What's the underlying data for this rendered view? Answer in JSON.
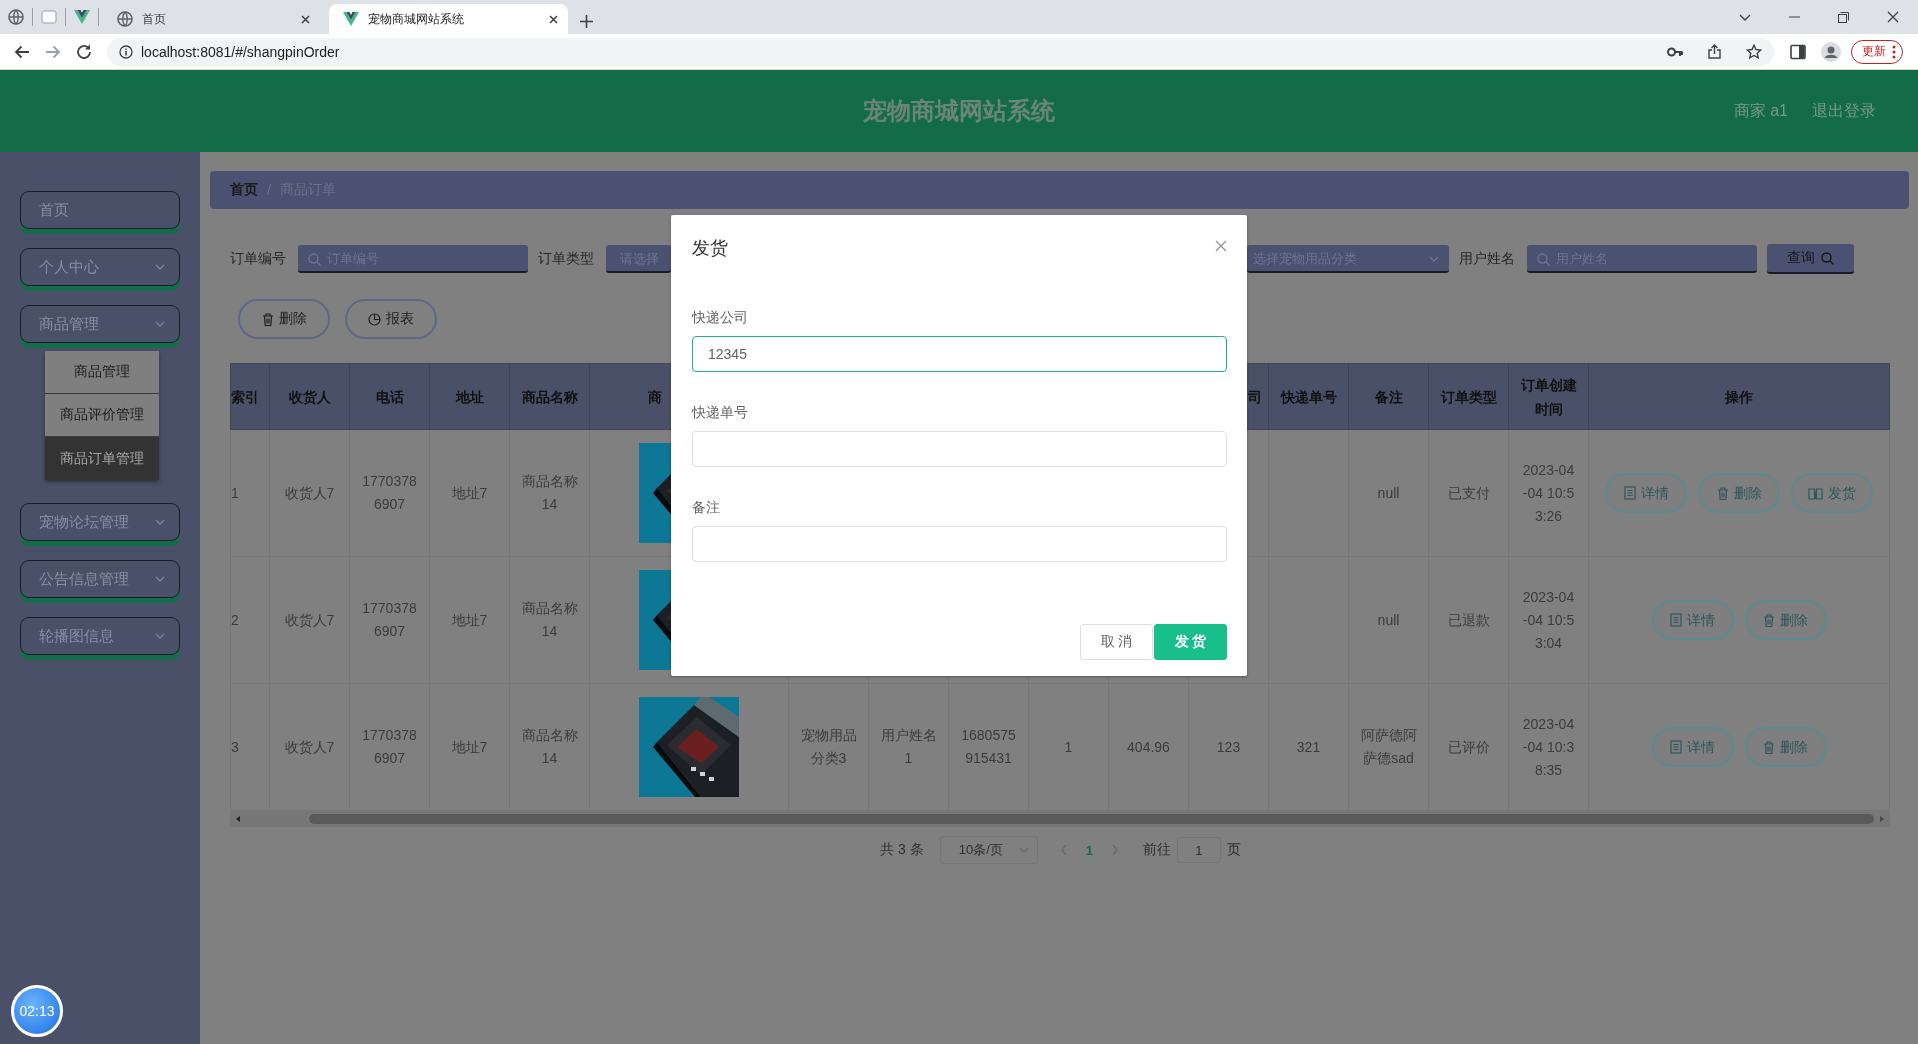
{
  "browser": {
    "tabs": [
      {
        "title": "首页",
        "kind": "globe",
        "selected": false
      },
      {
        "title": "宠物商城网站系统",
        "kind": "vue",
        "selected": true
      }
    ],
    "url": "localhost:8081/#/shangpinOrder",
    "update_button": "更新"
  },
  "header": {
    "title": "宠物商城网站系统",
    "user": "商家 a1",
    "logout": "退出登录"
  },
  "sidebar": {
    "items": [
      {
        "label": "首页",
        "kind": "link"
      },
      {
        "label": "个人中心",
        "kind": "menu"
      },
      {
        "label": "商品管理",
        "kind": "menu",
        "children": [
          {
            "label": "商品管理",
            "selected": false
          },
          {
            "label": "商品评价管理",
            "selected": false
          },
          {
            "label": "商品订单管理",
            "selected": true
          }
        ]
      },
      {
        "label": "宠物论坛管理",
        "kind": "menu"
      },
      {
        "label": "公告信息管理",
        "kind": "menu"
      },
      {
        "label": "轮播图信息",
        "kind": "menu"
      }
    ]
  },
  "breadcrumb": {
    "items": [
      "首页",
      "商品订单"
    ],
    "separator": "/"
  },
  "search": {
    "fields": [
      {
        "label": "订单编号",
        "placeholder": "订单编号",
        "kind": "input"
      },
      {
        "label": "订单类型",
        "placeholder": "请选择",
        "kind": "select"
      },
      {
        "placeholder": "选择宠物用品分类",
        "kind": "select"
      },
      {
        "label": "用户姓名",
        "placeholder": "用户姓名",
        "kind": "input"
      }
    ],
    "button": "查询"
  },
  "actions": [
    {
      "label": "删除",
      "kind": "delete"
    },
    {
      "label": "报表",
      "kind": "report"
    }
  ],
  "table": {
    "columns": {
      "index": "索引",
      "receiver": "收货人",
      "phone": "电话",
      "address": "地址",
      "product_name": "商品名称",
      "picture": "商",
      "courier": "司",
      "tracking_no": "快递单号",
      "remark": "备注",
      "order_type": "订单类型",
      "created_at": "订单创建时间",
      "actions": "操作"
    },
    "rows": [
      {
        "index": "1",
        "receiver": "收货人7",
        "phone": "17703786907",
        "address": "地址7",
        "product_name": "商品名称14",
        "remark": "null",
        "order_type": "已支付",
        "created_at": "2023-04-04 10:53:26",
        "actions": [
          {
            "label": "详情",
            "kind": "detail"
          },
          {
            "label": "删除",
            "kind": "delete"
          },
          {
            "label": "发货",
            "kind": "ship"
          }
        ]
      },
      {
        "index": "2",
        "receiver": "收货人7",
        "phone": "17703786907",
        "address": "地址7",
        "product_name": "商品名称14",
        "remark": "null",
        "order_type": "已退款",
        "created_at": "2023-04-04 10:53:04",
        "actions": [
          {
            "label": "详情",
            "kind": "detail"
          },
          {
            "label": "删除",
            "kind": "delete"
          }
        ]
      },
      {
        "index": "3",
        "receiver": "收货人7",
        "phone": "17703786907",
        "address": "地址7",
        "product_name": "商品名称14",
        "category": "宠物用品分类3",
        "user_name": "用户姓名1",
        "order_no": "1680575915431",
        "quantity": "1",
        "price": "404.96",
        "courier": "123",
        "tracking_no": "321",
        "remark": "阿萨德阿萨德sad",
        "order_type": "已评价",
        "created_at": "2023-04-04 10:38:35",
        "actions": [
          {
            "label": "详情",
            "kind": "detail"
          },
          {
            "label": "删除",
            "kind": "delete"
          }
        ]
      }
    ]
  },
  "pagination": {
    "total": "共 3 条",
    "page_size": "10条/页",
    "pages": [
      {
        "label": "1",
        "selected": true
      }
    ],
    "goto_label": "前往",
    "goto_value": "1",
    "goto_suffix": "页"
  },
  "dialog": {
    "title": "发货",
    "fields": [
      {
        "label": "快递公司",
        "value": "12345",
        "focused": true
      },
      {
        "label": "快递单号",
        "focused": false
      },
      {
        "label": "备注",
        "focused": false
      }
    ],
    "buttons": [
      {
        "label": "取 消",
        "kind": "default"
      },
      {
        "label": "发 货",
        "kind": "primary"
      }
    ]
  },
  "timer": "02:13"
}
